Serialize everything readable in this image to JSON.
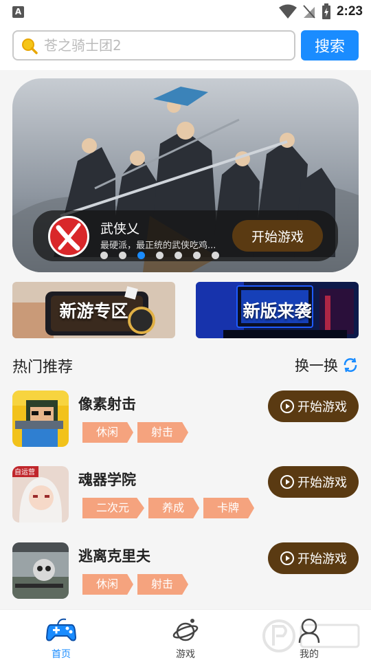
{
  "status_bar": {
    "time": "2:23",
    "app_indicator": "A"
  },
  "search": {
    "placeholder": "苍之骑士团2",
    "button_label": "搜索"
  },
  "banner": {
    "game_title": "武侠乂",
    "game_desc": "最硬派，最正统的武侠吃鸡...",
    "play_label": "开始游戏",
    "dots_total": 7,
    "active_dot": 2
  },
  "promos": [
    {
      "label": "新游专区"
    },
    {
      "label": "新版来袭"
    }
  ],
  "section": {
    "title": "热门推荐",
    "refresh_label": "换一换"
  },
  "games": [
    {
      "title": "像素射击",
      "tags": [
        "休闲",
        "射击"
      ],
      "play_label": "开始游戏"
    },
    {
      "title": "魂器学院",
      "tags": [
        "二次元",
        "养成",
        "卡牌"
      ],
      "play_label": "开始游戏"
    },
    {
      "title": "逃离克里夫",
      "tags": [
        "休闲",
        "射击"
      ],
      "play_label": "开始游戏"
    }
  ],
  "nav": [
    {
      "label": "首页",
      "active": true
    },
    {
      "label": "游戏",
      "active": false
    },
    {
      "label": "我的",
      "active": false
    }
  ],
  "colors": {
    "accent": "#1a8cff",
    "play_button": "#5a3a12",
    "tag": "#f5a37e"
  }
}
